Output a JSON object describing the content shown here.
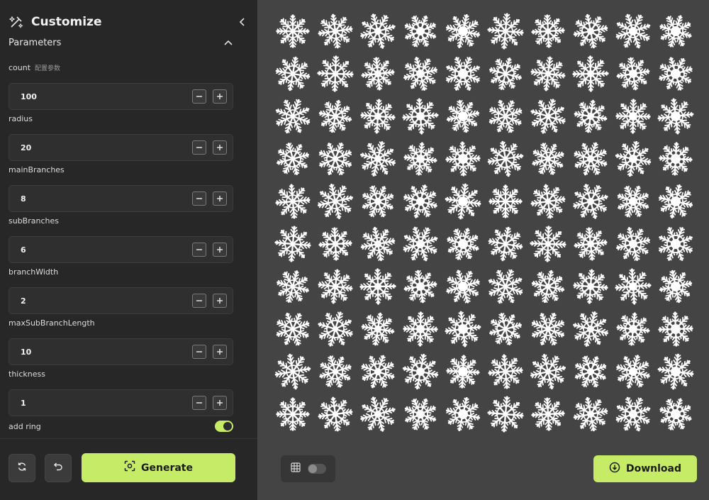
{
  "header": {
    "title": "Customize",
    "logo_icon": "magic-wand-icon",
    "collapse_icon": "chevron-left-icon"
  },
  "section": {
    "label": "Parameters",
    "chevron_icon": "chevron-up-icon"
  },
  "params": [
    {
      "label": "count",
      "hint": "配置参数",
      "value": "100"
    },
    {
      "label": "radius",
      "hint": "",
      "value": "20"
    },
    {
      "label": "mainBranches",
      "hint": "",
      "value": "8"
    },
    {
      "label": "subBranches",
      "hint": "",
      "value": "6"
    },
    {
      "label": "branchWidth",
      "hint": "",
      "value": "2"
    },
    {
      "label": "maxSubBranchLength",
      "hint": "",
      "value": "10"
    },
    {
      "label": "thickness",
      "hint": "",
      "value": "1"
    }
  ],
  "ring": {
    "label": "add ring",
    "enabled": true
  },
  "actions": {
    "refresh_icon": "refresh-icon",
    "undo_icon": "undo-icon",
    "generate_label": "Generate",
    "generate_icon": "scan-icon"
  },
  "canvas": {
    "grid_icon": "grid-icon",
    "grid_enabled": false,
    "download_label": "Download",
    "download_icon": "download-circle-icon",
    "flake_count": 100,
    "flake_color": "#ffffff"
  },
  "colors": {
    "accent": "#c6ec67",
    "sidebar": "#272727",
    "canvas": "#444444"
  }
}
